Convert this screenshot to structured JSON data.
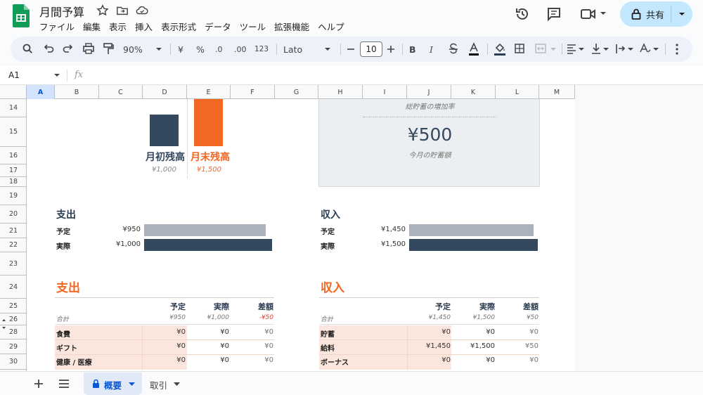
{
  "app": {
    "title": "月間予算",
    "menu": [
      "ファイル",
      "編集",
      "表示",
      "挿入",
      "表示形式",
      "データ",
      "ツール",
      "拡張機能",
      "ヘルプ"
    ],
    "share_label": "共有"
  },
  "toolbar": {
    "zoom": "90%",
    "currency": "¥",
    "percent": "%",
    "dec_minus": ".0",
    "dec_plus": ".00",
    "format_num": "123",
    "font": "Lato",
    "font_size": "10"
  },
  "formula": {
    "cell_ref": "A1",
    "fx": "fx"
  },
  "columns": [
    "A",
    "B",
    "C",
    "D",
    "E",
    "F",
    "G",
    "H",
    "I",
    "J",
    "K",
    "L",
    "M"
  ],
  "rows": [
    "14",
    "15",
    "16",
    "17",
    "18",
    "19",
    "20",
    "21",
    "22",
    "23",
    "24",
    "25",
    "26",
    "28",
    "29",
    "30"
  ],
  "balance": {
    "start_label": "月初残高",
    "start_value": "¥1,000",
    "end_label": "月末残高",
    "end_value": "¥1,500",
    "start_fill": 0.67,
    "end_fill": 1.0
  },
  "savings": {
    "rate_label": "総貯蓄の増加率",
    "amount": "¥500",
    "amount_label": "今月の貯蓄額"
  },
  "expense_chart": {
    "title": "支出",
    "rows": [
      {
        "label": "予定",
        "value": "¥950",
        "fill": 0.95
      },
      {
        "label": "実際",
        "value": "¥1,000",
        "fill": 1.0
      }
    ]
  },
  "income_chart": {
    "title": "収入",
    "rows": [
      {
        "label": "予定",
        "value": "¥1,450",
        "fill": 0.967
      },
      {
        "label": "実際",
        "value": "¥1,500",
        "fill": 1.0
      }
    ]
  },
  "expense_table": {
    "title": "支出",
    "headers": [
      "予定",
      "実際",
      "差額"
    ],
    "total": {
      "label": "合計",
      "planned": "¥950",
      "actual": "¥1,000",
      "diff": "-¥50"
    },
    "rows": [
      {
        "name": "食費",
        "planned": "¥0",
        "actual": "¥0",
        "diff": "¥0"
      },
      {
        "name": "ギフト",
        "planned": "¥0",
        "actual": "¥0",
        "diff": "¥0"
      },
      {
        "name": "健康 / 医療",
        "planned": "¥0",
        "actual": "¥0",
        "diff": "¥0"
      }
    ]
  },
  "income_table": {
    "title": "収入",
    "headers": [
      "予定",
      "実際",
      "差額"
    ],
    "total": {
      "label": "合計",
      "planned": "¥1,450",
      "actual": "¥1,500",
      "diff": "¥50"
    },
    "rows": [
      {
        "name": "貯蓄",
        "planned": "¥0",
        "actual": "¥0",
        "diff": "¥0"
      },
      {
        "name": "給料",
        "planned": "¥1,450",
        "actual": "¥1,500",
        "diff": "¥50"
      },
      {
        "name": "ボーナス",
        "planned": "¥0",
        "actual": "¥0",
        "diff": "¥0"
      }
    ]
  },
  "tabs": [
    {
      "label": "概要"
    },
    {
      "label": "取引"
    }
  ],
  "colors": {
    "navy": "#34495e",
    "orange": "#f26722",
    "gray_bar": "#aab2bd",
    "pink_cell": "#fbe6dd",
    "share_bg": "#c2e7ff"
  }
}
